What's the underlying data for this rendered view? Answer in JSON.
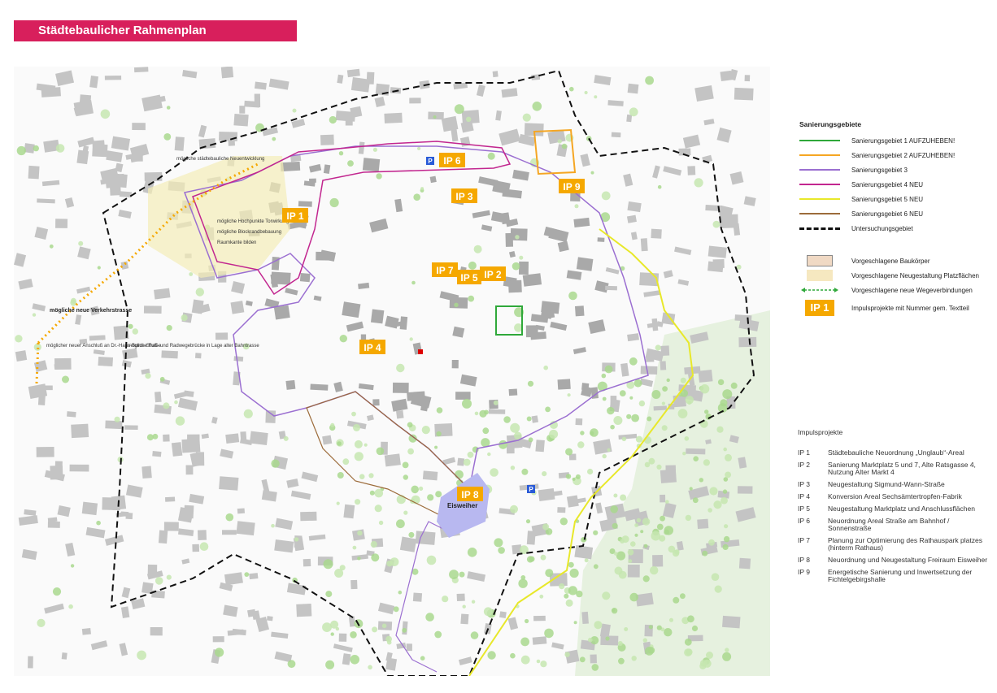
{
  "header": {
    "title": "Städtebaulicher Rahmenplan"
  },
  "colors": {
    "title_bg": "#d81f5c",
    "ip_badge": "#f5a800",
    "sg1": "#2fa83a",
    "sg2": "#f5a623",
    "sg3": "#9b6fd1",
    "sg4": "#c2268f",
    "sg5": "#e8e82a",
    "sg6": "#9c6b3a",
    "untersuchung": "#111111",
    "pond": "#b8b8f0"
  },
  "legend": {
    "heading": "Sanierungsgebiete",
    "lines": [
      {
        "label": "Sanierungsgebiet 1  AUFZUHEBEN!",
        "color": "#2fa83a"
      },
      {
        "label": "Sanierungsgebiet 2  AUFZUHEBEN!",
        "color": "#f5a623"
      },
      {
        "label": "Sanierungsgebiet 3",
        "color": "#9b6fd1"
      },
      {
        "label": "Sanierungsgebiet 4 NEU",
        "color": "#c2268f"
      },
      {
        "label": "Sanierungsgebiet 5 NEU",
        "color": "#e8e82a"
      },
      {
        "label": "Sanierungsgebiet 6 NEU",
        "color": "#9c6b3a"
      }
    ],
    "untersuchung": "Untersuchungsgebiet",
    "baukoerper": "Vorgeschlagene Baukörper",
    "platzflaechen": "Vorgeschlagene Neugestaltung Platzflächen",
    "wege": "Vorgeschlagene neue Wegeverbindungen",
    "ip_badge": "IP 1",
    "ip_desc": "Impulsprojekte mit Nummer gem. Textteil"
  },
  "impulsprojekte": {
    "heading": "Impulsprojekte",
    "items": [
      {
        "code": "IP 1",
        "text": "Städtebauliche Neuordnung „Unglaub“-Areal"
      },
      {
        "code": "IP 2",
        "text": "Sanierung Marktplatz 5 und 7, Alte Ratsgasse 4, Nutzung Alter Markt 4"
      },
      {
        "code": "IP 3",
        "text": "Neugestaltung Sigmund-Wann-Straße"
      },
      {
        "code": "IP 4",
        "text": "Konversion Areal Sechsämtertropfen-Fabrik"
      },
      {
        "code": "IP 5",
        "text": "Neugestaltung Marktplatz und Anschlussflächen"
      },
      {
        "code": "IP 6",
        "text": "Neuordnung Areal Straße am Bahnhof / Sonnenstraße"
      },
      {
        "code": "IP 7",
        "text": "Planung zur Optimierung des Rathauspark platzes (hinterm Rathaus)"
      },
      {
        "code": "IP 8",
        "text": "Neuordnung und Neugestaltung Freiraum Eisweiher"
      },
      {
        "code": "IP 9",
        "text": "Energetische Sanierung und Inwertsetzung der Fichtelgebirgshalle"
      }
    ]
  },
  "map": {
    "ip_labels": [
      "IP 1",
      "IP 2",
      "IP 3",
      "IP 4",
      "IP 5",
      "IP 6",
      "IP 7",
      "IP 8",
      "IP 9"
    ],
    "pond_name": "Eisweiher",
    "verkehrstrasse": "mögliche neue  Verkehrstrasse",
    "anschluss": "möglicher neuer Anschluß an Dr.-Hans-Bunte-Straße",
    "neuentwicklung": "mögliche städtebauliche Neuentwicklung",
    "fussweg": "mögliche Fuß- und Radwegebrücke in Lage alter Bahntrasse",
    "hochpunkte": "mögliche Hochpunkte Torwirkung",
    "raumkante": "Raumkante bilden",
    "bebauung": "mögliche Blockrandbebauung"
  }
}
